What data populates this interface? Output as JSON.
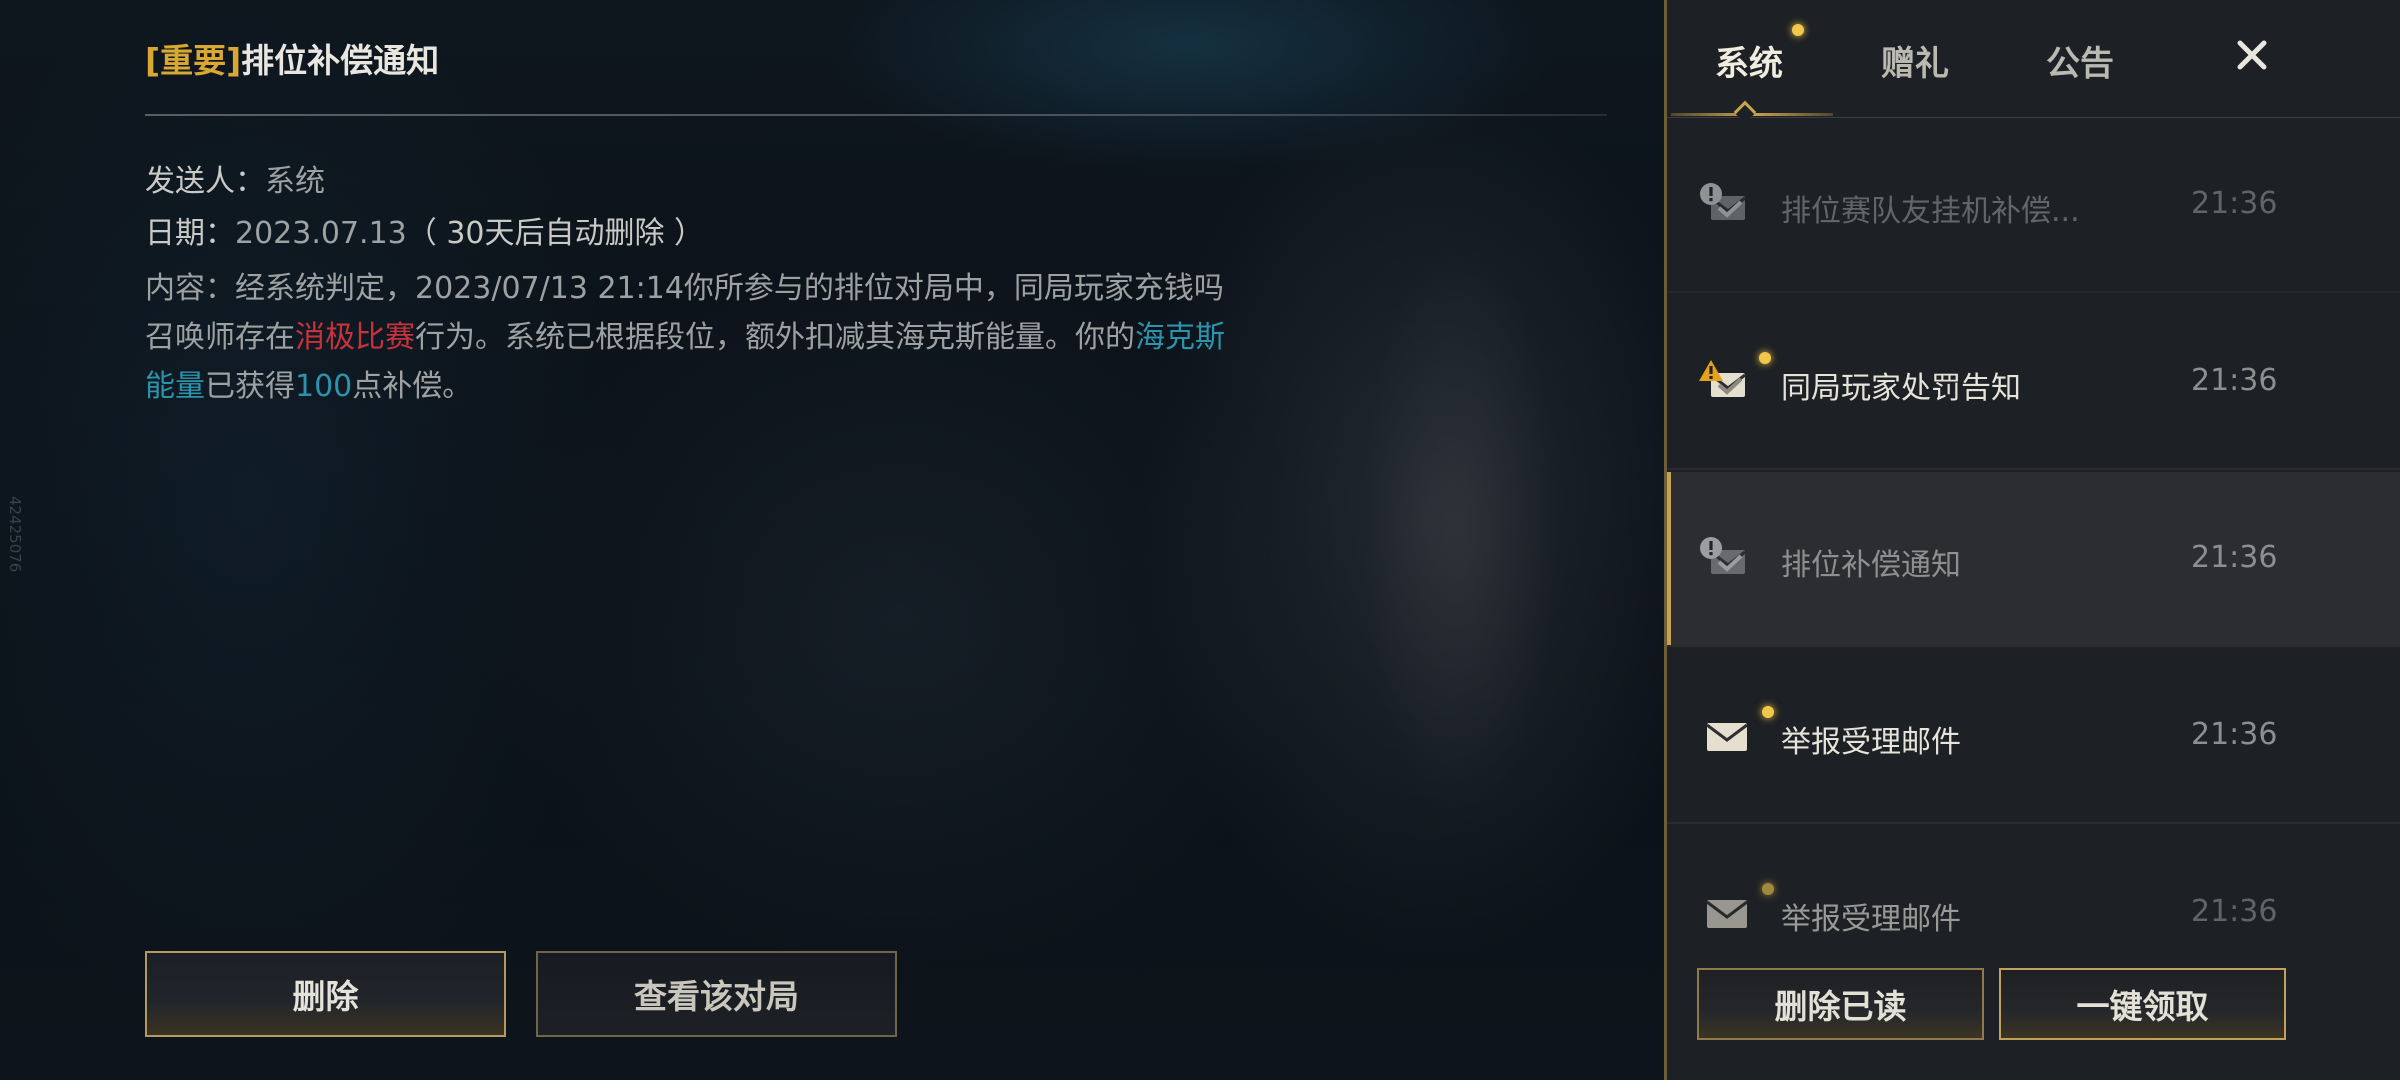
{
  "side_number": "42425076",
  "mail": {
    "title_tag": "[重要]",
    "title": "排位补偿通知",
    "sender_label": "发送人：",
    "sender_value": "系统",
    "date_label": "日期：",
    "date_value": "2023.07.13",
    "date_note": "（ 30天后自动删除 ）",
    "body": {
      "part1": "内容：经系统判定，2023/07/13 21:14你所参与的排位对局中，同局玩家充钱吗召唤师存在",
      "highlight_red": "消极比赛",
      "part2": "行为。系统已根据段位，额外扣减其海克斯能量。你的",
      "highlight_blue": "海克斯能量",
      "part3": "已获得",
      "highlight_number": "100",
      "part4": "点补偿。"
    },
    "buttons": {
      "delete": "删除",
      "view_match": "查看该对局"
    }
  },
  "panel": {
    "tabs": [
      {
        "label": "系统",
        "active": true,
        "has_dot": true
      },
      {
        "label": "赠礼",
        "active": false
      },
      {
        "label": "公告",
        "active": false
      }
    ],
    "close_icon": "close-icon",
    "items": [
      {
        "title": "排位赛队友挂机补偿...",
        "time": "21:36",
        "icon": "important-mail-read-icon",
        "read": true,
        "dot": false
      },
      {
        "title": "同局玩家处罚告知",
        "time": "21:36",
        "icon": "important-mail-unread-icon",
        "read": false,
        "dot": true
      },
      {
        "title": "排位补偿通知",
        "time": "21:36",
        "icon": "important-mail-read-icon",
        "read": true,
        "dot": false,
        "selected": true
      },
      {
        "title": "举报受理邮件",
        "time": "21:36",
        "icon": "mail-icon",
        "read": false,
        "dot": true
      },
      {
        "title": "举报受理邮件",
        "time": "21:36",
        "icon": "mail-icon",
        "read": false,
        "dot": true
      }
    ],
    "buttons": {
      "delete_read": "删除已读",
      "claim_all": "一键领取"
    }
  },
  "colors": {
    "accent_gold": "#d9a833",
    "highlight_red": "#c8323c",
    "highlight_blue": "#2b93ab",
    "unread_dot": "#f3c84a"
  }
}
